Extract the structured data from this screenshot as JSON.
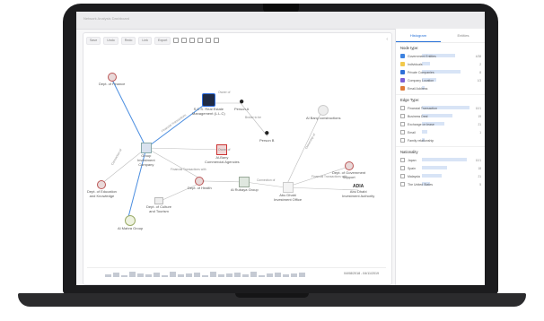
{
  "window": {
    "title": "Network Analysis Dashboard"
  },
  "toolbar": {
    "items": [
      "Save",
      "Undo",
      "Redo",
      "Link",
      "Export"
    ]
  },
  "nodes": [
    {
      "key": "finance",
      "label": "Dept. of Finance",
      "icon": "building-icon"
    },
    {
      "key": "mgmt",
      "label": "S.C.S. Real Estate\nManagement (L.L.C)",
      "icon": "company-icon"
    },
    {
      "key": "p1",
      "label": "Person A",
      "icon": "person-icon"
    },
    {
      "key": "p2",
      "label": "Person B",
      "icon": "person-icon"
    },
    {
      "key": "almara",
      "label": "Al Bany constructions",
      "icon": "location-icon"
    },
    {
      "key": "group",
      "label": "Group\nInvestment\nCompany",
      "icon": "company-icon"
    },
    {
      "key": "commercial",
      "label": "Al-Bany\nCommercial Agencies",
      "icon": "company-icon"
    },
    {
      "key": "education",
      "label": "Dept. of Education\nand Knowledge",
      "icon": "building-icon"
    },
    {
      "key": "health",
      "label": "Dept. of Health",
      "icon": "building-icon"
    },
    {
      "key": "rabaya",
      "label": "Al Rubaya Group",
      "icon": "company-icon"
    },
    {
      "key": "office",
      "label": "Abu Dhabi\nInvestment Office",
      "icon": "company-icon"
    },
    {
      "key": "support",
      "label": "Dept. of Government\nSupport",
      "icon": "building-icon"
    },
    {
      "key": "culture",
      "label": "Dept. of Culture\nand Tourism",
      "icon": "building-icon"
    },
    {
      "key": "authority",
      "label": "Abu Dhabi\nInvestment Authority",
      "icon": "company-icon"
    },
    {
      "key": "mahra",
      "label": "Al Mahra Group",
      "icon": "company-icon"
    }
  ],
  "edge_labels": [
    "Owner of",
    "Broker to be",
    "Owner of",
    "Financial Transactions",
    "Ownership of",
    "Financial Transactions with",
    "Connection of",
    "Financial Transactions with",
    "Connection of"
  ],
  "timeline": {
    "date_range": "04/08/2018 - 04/11/2019"
  },
  "panel": {
    "tabs": [
      "Histogram",
      "Entities"
    ],
    "node_types": {
      "title": "Node type:",
      "meta": "Show\ndetails",
      "items": [
        {
          "label": "Government Entities",
          "value": "4/38",
          "color": "#3d82e0",
          "frac": 0.6
        },
        {
          "label": "Individuals",
          "value": "2",
          "color": "#f2c94c",
          "frac": 0.15
        },
        {
          "label": "Private Companies",
          "value": "8",
          "color": "#2e6fd8",
          "frac": 0.7
        },
        {
          "label": "Company Location",
          "value": "1/3",
          "color": "#7b5fd6",
          "frac": 0.25
        },
        {
          "label": "Email Address",
          "value": "",
          "color": "#e07b39",
          "frac": 0.05
        }
      ]
    },
    "edge_types": {
      "title": "Edge Type:",
      "meta": "Show\ndetails",
      "items": [
        {
          "label": "Financial Transaction",
          "value": "10/1",
          "frac": 0.85
        },
        {
          "label": "Business Deal",
          "value": "19",
          "frac": 0.55
        },
        {
          "label": "Exchange on lease",
          "value": "21",
          "frac": 0.4
        },
        {
          "label": "Email",
          "value": "1",
          "frac": 0.1
        },
        {
          "label": "Family relationship",
          "value": "",
          "frac": 0.05
        }
      ]
    },
    "nationality": {
      "title": "Nationality",
      "meta": "Show\ndetails",
      "items": [
        {
          "label": "Japan",
          "value": "10/1",
          "frac": 0.8
        },
        {
          "label": "Spain",
          "value": "18",
          "frac": 0.45
        },
        {
          "label": "Malaysia",
          "value": "21",
          "frac": 0.35
        },
        {
          "label": "The United States",
          "value": "5",
          "frac": 0.15
        }
      ]
    }
  }
}
